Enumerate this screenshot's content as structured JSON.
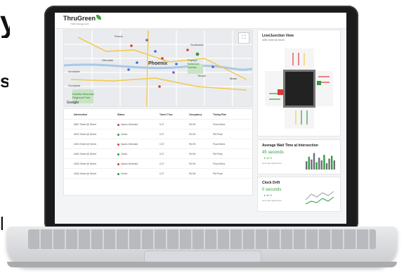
{
  "page_edges": {
    "top_char": "y",
    "middle_char": "s",
    "bottom_char": "l"
  },
  "app": {
    "logo_text": "ThruGreen",
    "logo_subtitle": "Traffic Management"
  },
  "map": {
    "labels": {
      "peoria": "Peoria",
      "scottsdale": "Scottsdale",
      "phoenix": "Phoenix",
      "glendale": "Glendale",
      "tempe": "Tempe",
      "mesa": "Mesa",
      "avondale": "Avondale",
      "goodyear": "Goodyear",
      "papago": "Papago Botanical Garden",
      "estrella": "Estrella Mountain Regional Park"
    },
    "credit": "Google",
    "fullscreen_icon": "fullscreen-icon"
  },
  "table": {
    "headers": [
      "Intersection",
      "Status",
      "Travel Time",
      "Occupancy",
      "Timing Plan"
    ],
    "rows": [
      {
        "intersection": "6667 Street @ Street",
        "status": "Issues Detected",
        "status_color": "#d93a3a",
        "travel": "0:27",
        "occupancy": "95.3%",
        "plan": "Flood Work"
      },
      {
        "intersection": "6032 Street @ Street",
        "status": "Green",
        "status_color": "#2e9e3a",
        "travel": "0:27",
        "occupancy": "95.3%",
        "plan": "PM Peak"
      },
      {
        "intersection": "4003 Street @ Street",
        "status": "Issues Detected",
        "status_color": "#d93a3a",
        "travel": "0:27",
        "occupancy": "95.3%",
        "plan": "Flood Work"
      },
      {
        "intersection": "4000 Street @ Street",
        "status": "Green",
        "status_color": "#2e9e3a",
        "travel": "0:27",
        "occupancy": "95.3%",
        "plan": "PM Peak"
      },
      {
        "intersection": "4040 Street @ Street",
        "status": "Issues Detected",
        "status_color": "#d93a3a",
        "travel": "0:27",
        "occupancy": "95.3%",
        "plan": "Flood Work"
      },
      {
        "intersection": "4040 Street @ Street",
        "status": "Green",
        "status_color": "#2e9e3a",
        "travel": "0:27",
        "occupancy": "95.3%",
        "plan": "PM Peak"
      }
    ]
  },
  "live_view": {
    "title": "Live/Junction View",
    "subtitle": "4055 Street @ Street"
  },
  "wait_time": {
    "title": "Average Wait Time at Intersection",
    "value": "45 seconds",
    "delta": "▼ 40 %",
    "note": "since last adjustment",
    "bars": [
      0.45,
      0.7,
      0.55,
      0.9,
      0.4,
      0.65,
      0.5,
      0.8,
      0.35,
      0.6,
      0.75,
      0.5
    ]
  },
  "clock_drift": {
    "title": "Clock Drift",
    "value": "0 seconds",
    "delta": "▼ 40 %",
    "note": "since last adjustment"
  },
  "colors": {
    "accent_green": "#2e9e3a",
    "alert_red": "#d93a3a",
    "brand_leaf": "#3fa43a"
  }
}
